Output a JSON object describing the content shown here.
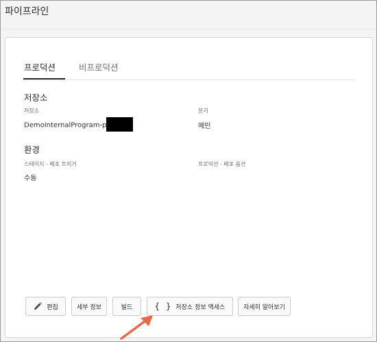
{
  "page": {
    "title": "파이프라인"
  },
  "tabs": [
    {
      "label": "프로덕션",
      "selected": true
    },
    {
      "label": "비프로덕션",
      "selected": false
    }
  ],
  "repository": {
    "section_title": "저장소",
    "repo_label": "저장소",
    "repo_value": "DemoInternalProgram-p",
    "branch_label": "분기",
    "branch_value": "메인"
  },
  "environment": {
    "section_title": "환경",
    "stage_label": "스테이지 - 배포 트리거",
    "stage_value": "수동",
    "prod_label": "프로덕션 - 배포 옵션"
  },
  "buttons": {
    "edit": "편집",
    "details": "세부 정보",
    "build": "빌드",
    "repo_access": "저장소 정보 액세스",
    "learn_more": "자세히 알아보기"
  },
  "icons": {
    "edit": "pencil-icon",
    "repo_access": "curly-braces-icon"
  },
  "colors": {
    "annotation_arrow": "#e8684a"
  }
}
